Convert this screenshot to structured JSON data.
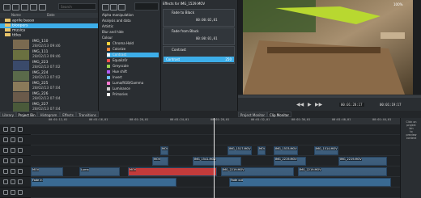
{
  "bin": {
    "search_placeholder": "Search",
    "col_name": "Name",
    "col_date": "Date",
    "folders": [
      "aprile basso",
      "bloopers",
      "musica",
      "titles"
    ],
    "clips": [
      {
        "title": "IMG_110",
        "date": "28/02/13 09:46"
      },
      {
        "title": "IMG_111",
        "date": "28/02/13 09:46"
      },
      {
        "title": "IMG_223",
        "date": "28/02/13 07:02"
      },
      {
        "title": "IMG_224",
        "date": "28/02/13 07:02"
      },
      {
        "title": "IMG_225",
        "date": "28/02/13 07:04"
      },
      {
        "title": "IMG_226",
        "date": "28/02/13 07:04"
      },
      {
        "title": "IMG_227",
        "date": "28/02/13 07:04"
      }
    ]
  },
  "effects": {
    "items": [
      "Alpha manipulation",
      "Analysis and data",
      "Artistic",
      "Blur and hide",
      "Colour",
      "Chroma Hold",
      "Colorize",
      "Contrast",
      "Equaliz0r",
      "Greyscale",
      "Hue shift",
      "Invert",
      "Luma/RGB/Gamma",
      "Luminance",
      "Primaries"
    ],
    "colors": [
      "#ffd23f",
      "#ff8a3d",
      "#ffffff",
      "#ff4f4f",
      "#9fd34f",
      "#b35cff",
      "#6cc4ff",
      "#ff7ad1",
      "#cfcfcf",
      "#ffffff"
    ]
  },
  "stack": {
    "header": "Effects for IMG_1529.MOV",
    "fade_to_black": "Fade to Black",
    "fade_from_black": "Fade from Black",
    "contrast": "Contrast",
    "contrast_param": "Contrast",
    "contrast_value": "250",
    "timecode1": "00:00:02,01",
    "timecode2": "00:00:01,01"
  },
  "monitor": {
    "zoom": "100%",
    "position": "00:01:28:17",
    "total": "00:01:19:17",
    "tabs": [
      "Project Monitor",
      "Clip Monitor"
    ]
  },
  "tabs": [
    "Library",
    "Project Bin",
    "Histogram",
    "Effects",
    "Transitions"
  ],
  "ruler": [
    "00:01:12,01",
    "00:01:16,01",
    "00:01:20,01",
    "00:01:24,01",
    "00:01:28,01",
    "00:01:32,01",
    "00:01:36,01",
    "00:01:40,01",
    "00:01:44,01"
  ],
  "clip_labels": [
    "MOV",
    "IMG_1517.MOV",
    "MOV",
    "IMG_1533.MOV",
    "IMG_1514.MOV",
    "MOV",
    "IMG_1541.MOV",
    "IMG_2219.MOV",
    "IMG_2219.MOV",
    "MOV",
    "Luma",
    "MOV",
    "IMG_2219.MOV",
    "IMG_2219.MOV",
    "Fade in",
    "Fade out"
  ],
  "side_labels": [
    "Click on",
    "project",
    "bin",
    "to",
    "preview",
    "content"
  ]
}
